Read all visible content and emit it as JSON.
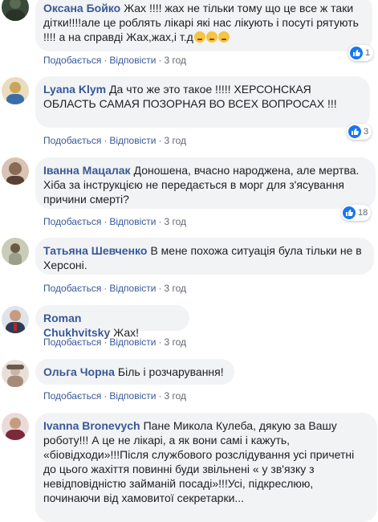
{
  "actions": {
    "like": "Подобається",
    "reply": "Відповісти",
    "sep": "·"
  },
  "comments": [
    {
      "author": "Оксана Бойко",
      "text": "Жах !!!! жах не тільки тому що це все ж таки дітки!!!!але це роблять лікарі які нас лікують і посуті рятують !!!! а на справді Жах,жах,і т.д",
      "time": "3 год",
      "likes": "1",
      "avatar_color": "#3a4a3a"
    },
    {
      "author": "Lyana Klym",
      "text": "Да что же это такое !!!!! ХЕРСОНСКАЯ ОБЛАСТЬ САМАЯ ПОЗОРНАЯ ВО ВСЕХ ВОПРОСАХ !!!",
      "time": "3 год",
      "likes": "3",
      "avatar_color": "#c9a45a"
    },
    {
      "author": "Іванна Мацалак",
      "text": "Доношена, вчасно народжена, але мертва. Хіба за інструкцією не передається в морг для з'ясування причини смерті?",
      "time": "3 год",
      "likes": "18",
      "avatar_color": "#8a6a55"
    },
    {
      "author": "Татьяна Шевченко",
      "text": "В мене похожа ситуація була тільки не в Херсоні.",
      "time": "3 год",
      "avatar_color": "#9aa08a"
    },
    {
      "author": "Roman Chukhvitsky",
      "text": "Жах!",
      "time": "3 год",
      "avatar_color": "#2f3b55"
    },
    {
      "author": "Ольга Чорна",
      "text": "Біль і розчарування!",
      "time": "3 год",
      "avatar_color": "#c7b6a8"
    },
    {
      "author": "Ivanna Bronevych",
      "text": "Пане Микола Кулеба, дякую за Вашу роботу!!! А це не лікарі, а як вони самі і кажуть, «біовідходи»!!!Після службового розслідування усі причетні до цього жахіття повинні буди звільнені « у зв'язку з невідповідністю займаній посаді»!!!Усі, підкреслюю, починаючи від хамовитої секретарки...",
      "time": "",
      "avatar_color": "#7a2a3a"
    }
  ],
  "colors": {
    "author": "#385898",
    "bubble": "#f2f3f5",
    "meta": "#606770",
    "like": "#1877f2"
  }
}
